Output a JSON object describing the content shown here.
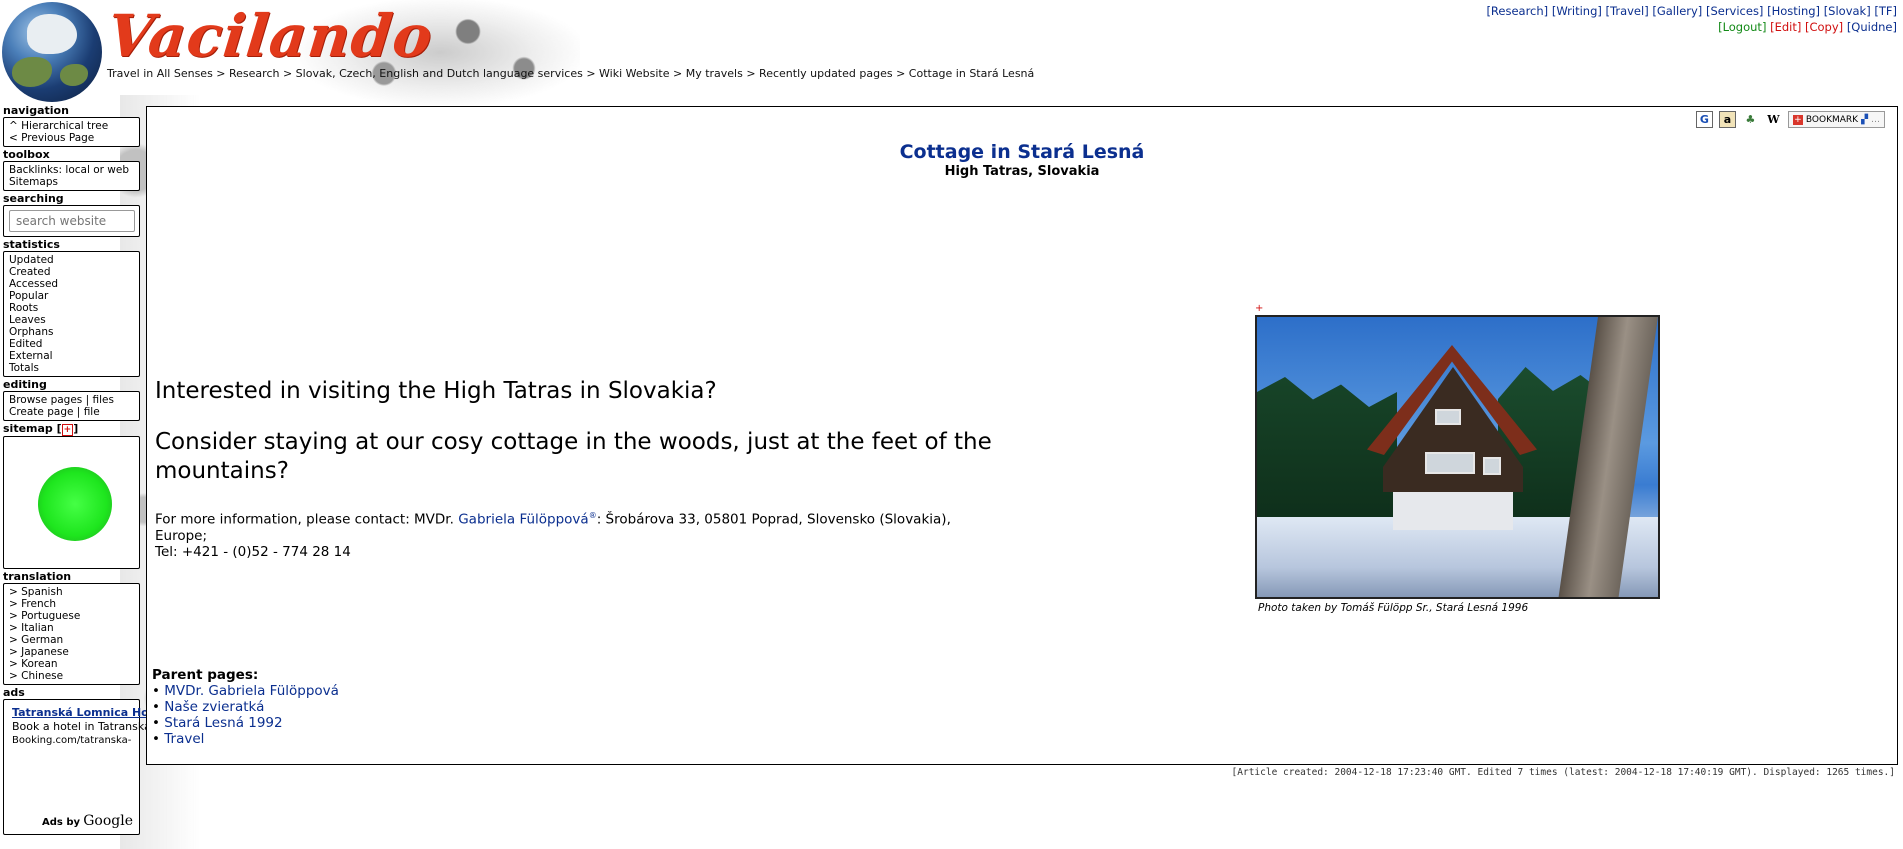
{
  "header": {
    "logo_text": "Vacilando",
    "breadcrumb": "Travel in All Senses > Research > Slovak, Czech, English and Dutch language services > Wiki Website > My travels > Recently updated pages > Cottage in Stará Lesná",
    "topnav_row1": [
      "[Research]",
      "[Writing]",
      "[Travel]",
      "[Gallery]",
      "[Services]",
      "[Hosting]",
      "[Slovak]",
      "[TF]"
    ],
    "topnav_logout": "[Logout]",
    "topnav_edit": "[Edit]",
    "topnav_copy": "[Copy]",
    "topnav_quidne": "[Quidne]"
  },
  "sidebar": {
    "navigation": {
      "title": "navigation",
      "items": [
        "^ Hierarchical tree",
        "< Previous Page"
      ]
    },
    "toolbox": {
      "title": "toolbox",
      "items": [
        "Backlinks: local or web",
        "Sitemaps"
      ]
    },
    "searching": {
      "title": "searching",
      "placeholder": "search website"
    },
    "statistics": {
      "title": "statistics",
      "items": [
        "Updated",
        "Created",
        "Accessed",
        "Popular",
        "Roots",
        "Leaves",
        "Orphans",
        "Edited",
        "External",
        "Totals"
      ]
    },
    "editing": {
      "title": "editing",
      "browse": "Browse pages",
      "files": "files",
      "create": "Create page",
      "file": "file",
      "sep": "|"
    },
    "sitemap": {
      "title": "sitemap",
      "toggle": "+"
    },
    "translation": {
      "title": "translation",
      "items": [
        "> Spanish",
        "> French",
        "> Portuguese",
        "> Italian",
        "> German",
        "> Japanese",
        "> Korean",
        "> Chinese"
      ]
    },
    "ads": {
      "title": "ads",
      "ad_title": "Tatranská Lomnica Hotels",
      "ad_text": "Book a hotel in Tatranská Lomnica. No reservation costs. Great rates!",
      "ad_url": "Booking.com/tatranska-lc",
      "ads_by": "Ads by",
      "google": "Google"
    }
  },
  "main": {
    "bookmark_label": "BOOKMARK",
    "title": "Cottage in Stará Lesná",
    "subtitle": "High Tatras, Slovakia",
    "intro_1": "Interested in visiting the High Tatras in Slovakia?",
    "intro_2": "Consider staying at our cosy cottage in the woods, just at the feet of the mountains?",
    "contact_prefix": "For more information, please contact: MVDr.",
    "contact_name": "Gabriela Fülöppová",
    "contact_mark": "®",
    "contact_suffix": ": Šrobárova 33, 05801 Poprad, Slovensko (Slovakia), Europe;",
    "contact_tel": "Tel: +421 - (0)52 - 774 28 14",
    "photo_marker": "+",
    "photo_caption": "Photo taken by Tomáš Fülöpp Sr., Stará Lesná 1996",
    "parents_label": "Parent pages:",
    "parents": [
      "MVDr. Gabriela Fülöppová",
      "Naše zvieratká",
      "Stará Lesná 1992",
      "Travel"
    ]
  },
  "footer": {
    "text": "[Article created: 2004-12-18 17:23:40 GMT. Edited 7 times (latest: 2004-12-18 17:40:19 GMT). Displayed: 1265 times.]"
  }
}
